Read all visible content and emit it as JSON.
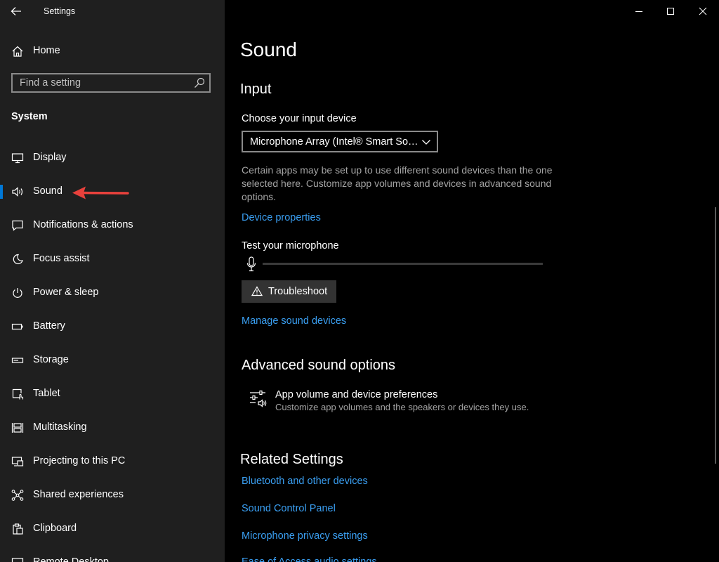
{
  "window": {
    "title": "Settings",
    "controls": {
      "minimize": "minimize-icon",
      "maximize": "maximize-icon",
      "close": "close-icon"
    }
  },
  "sidebar": {
    "home_label": "Home",
    "search_placeholder": "Find a setting",
    "section_label": "System",
    "selected_index": 1,
    "items": [
      {
        "label": "Display",
        "icon": "display-icon"
      },
      {
        "label": "Sound",
        "icon": "sound-icon"
      },
      {
        "label": "Notifications & actions",
        "icon": "notifications-icon"
      },
      {
        "label": "Focus assist",
        "icon": "moon-icon"
      },
      {
        "label": "Power & sleep",
        "icon": "power-icon"
      },
      {
        "label": "Battery",
        "icon": "battery-icon"
      },
      {
        "label": "Storage",
        "icon": "storage-icon"
      },
      {
        "label": "Tablet",
        "icon": "tablet-icon"
      },
      {
        "label": "Multitasking",
        "icon": "multitasking-icon"
      },
      {
        "label": "Projecting to this PC",
        "icon": "projecting-icon"
      },
      {
        "label": "Shared experiences",
        "icon": "shared-experiences-icon"
      },
      {
        "label": "Clipboard",
        "icon": "clipboard-icon"
      },
      {
        "label": "Remote Desktop",
        "icon": "remote-desktop-icon"
      }
    ]
  },
  "main": {
    "page_title": "Sound",
    "input": {
      "heading": "Input",
      "choose_label": "Choose your input device",
      "device_value": "Microphone Array (Intel® Smart So…",
      "description": "Certain apps may be set up to use different sound devices than the one selected here. Customize app volumes and devices in advanced sound options.",
      "device_properties_link": "Device properties",
      "test_label": "Test your microphone",
      "mic_level": 0,
      "troubleshoot_label": "Troubleshoot",
      "manage_link": "Manage sound devices"
    },
    "advanced": {
      "heading": "Advanced sound options",
      "pref_title": "App volume and device preferences",
      "pref_desc": "Customize app volumes and the speakers or devices they use."
    },
    "related": {
      "heading": "Related Settings",
      "links": [
        "Bluetooth and other devices",
        "Sound Control Panel",
        "Microphone privacy settings",
        "Ease of Access audio settings"
      ]
    }
  },
  "colors": {
    "accent": "#0078d7",
    "link": "#3a9ff2",
    "sidebar_bg": "#1f1f1f",
    "main_bg": "#000000",
    "annotation_arrow": "#e8413c"
  }
}
